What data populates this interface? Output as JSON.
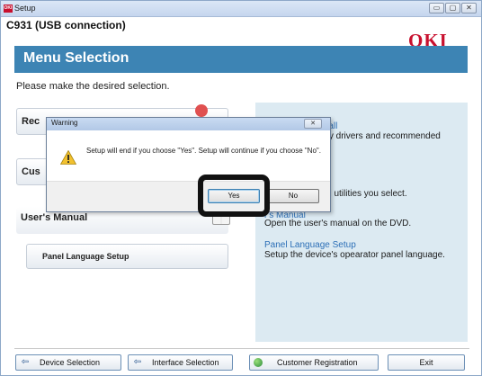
{
  "window": {
    "title": "Setup",
    "app_icon": "OKI",
    "controls": [
      "▭",
      "▢",
      "✕"
    ]
  },
  "header": {
    "model": "C931 (USB connection)",
    "logo": "OKI",
    "banner_title": "Menu Selection"
  },
  "prompt": "Please make the desired selection.",
  "menu": {
    "items": [
      {
        "label": "Rec"
      },
      {
        "label": "Cus"
      },
      {
        "label": "User's Manual"
      },
      {
        "label": "Panel Language Setup"
      }
    ]
  },
  "descriptions": {
    "recommended_link": "nstall",
    "recommended_desc": "sary drivers and recommended",
    "custom_desc": "and utilities you select.",
    "manual_link": "r's Manual",
    "manual_desc": "Open the user's manual on the DVD.",
    "panel_link": "Panel Language Setup",
    "panel_desc": "Setup the device's opearator panel language."
  },
  "nav": {
    "device_selection": "Device Selection",
    "interface_selection": "Interface Selection",
    "customer_registration": "Customer Registration",
    "exit": "Exit",
    "back_arrow": "⇦"
  },
  "dialog": {
    "title": "Warning",
    "close": "✕",
    "message": "Setup will end if you choose \"Yes\". Setup will continue if you choose \"No\".",
    "yes": "Yes",
    "no": "No"
  },
  "colors": {
    "banner": "#3d84b4",
    "logo": "#c8102e",
    "link": "#2c6fb7",
    "panel_bg": "#dceaf2"
  }
}
